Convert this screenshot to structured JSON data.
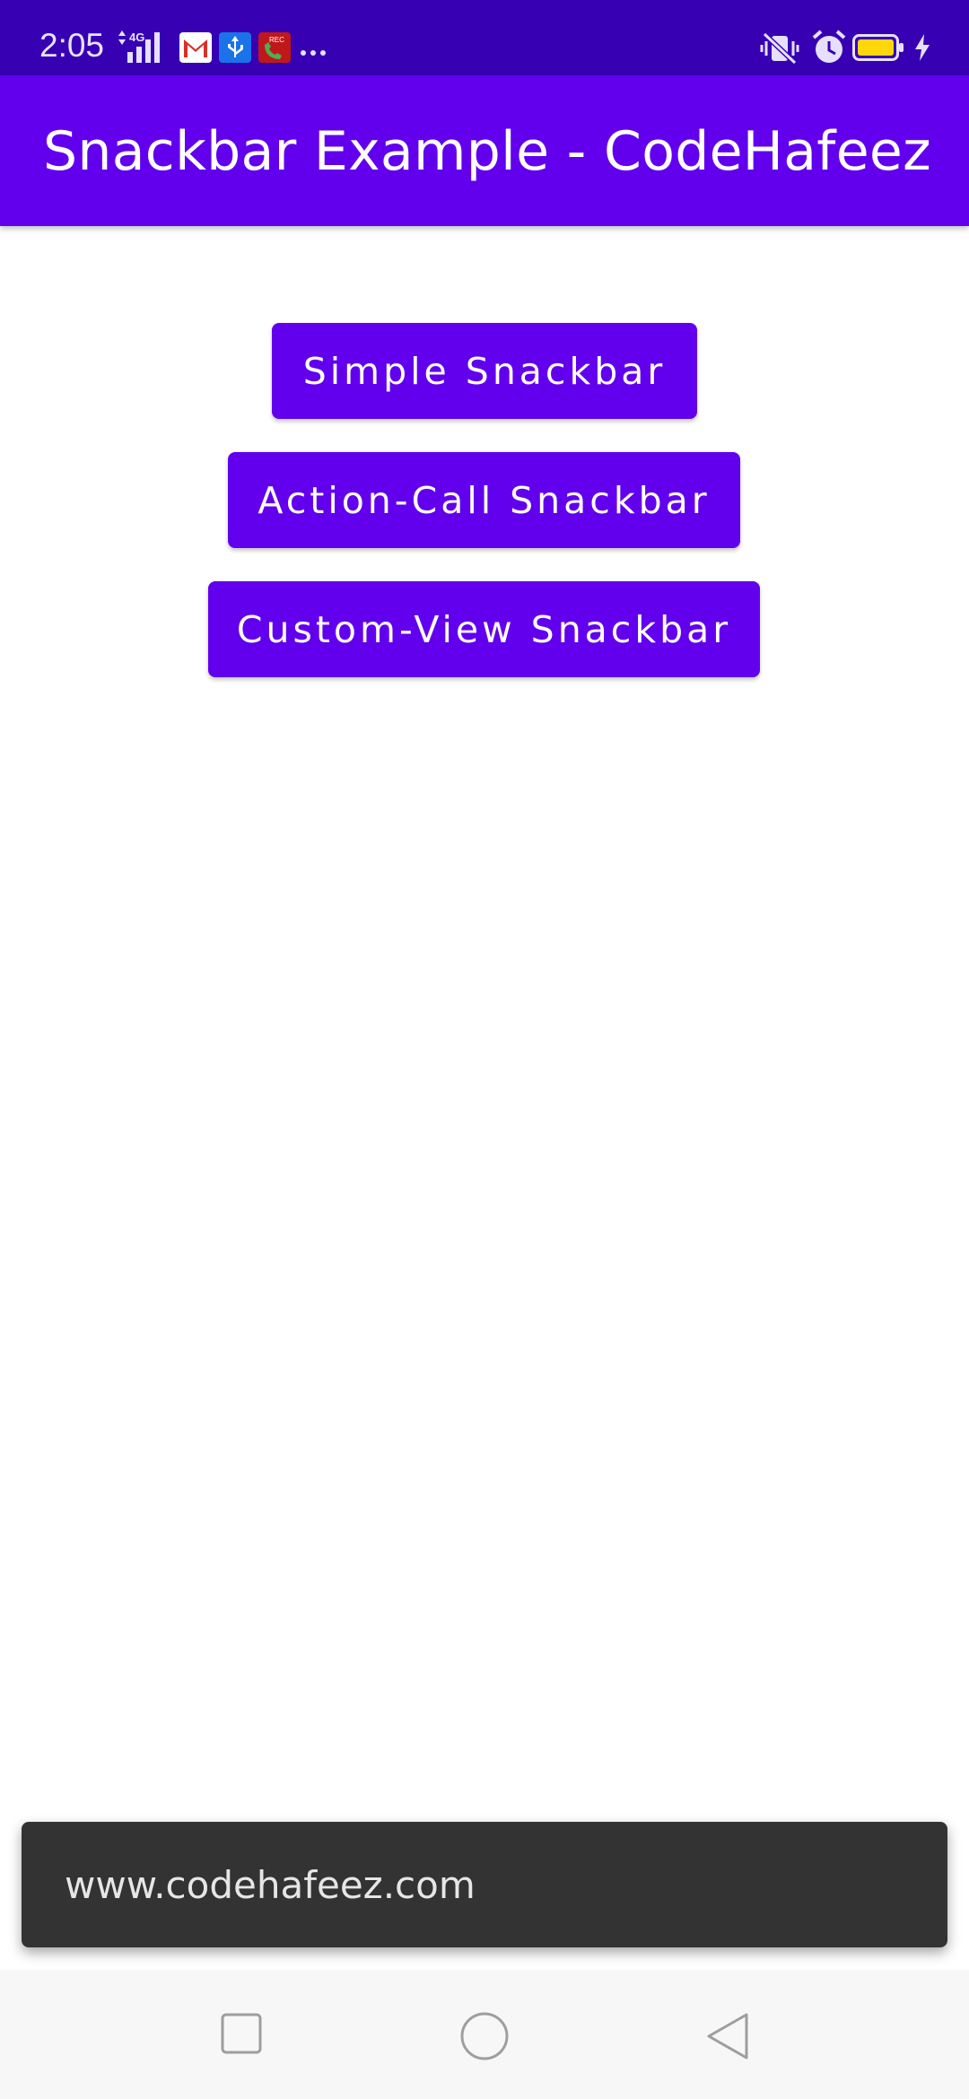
{
  "status_bar": {
    "time": "2:05",
    "network": "4G",
    "icons": [
      "signal-icon",
      "gmail-icon",
      "usb-icon",
      "call-recorder-icon",
      "more-notifications-icon",
      "vibrate-icon",
      "alarm-icon",
      "battery-icon",
      "charging-icon"
    ],
    "battery_color": "#ffd60a"
  },
  "app_bar": {
    "title": "Snackbar Example - CodeHafeez"
  },
  "buttons": {
    "simple": "Simple Snackbar",
    "action_call": "Action-Call Snackbar",
    "custom_view": "Custom-View Snackbar"
  },
  "snackbar": {
    "message": "www.codehafeez.com"
  },
  "colors": {
    "primary": "#6200ee",
    "primary_dark": "#3700b3",
    "snackbar_bg": "#333333"
  },
  "nav_bar": {
    "icons": [
      "recents-icon",
      "home-icon",
      "back-icon"
    ]
  }
}
